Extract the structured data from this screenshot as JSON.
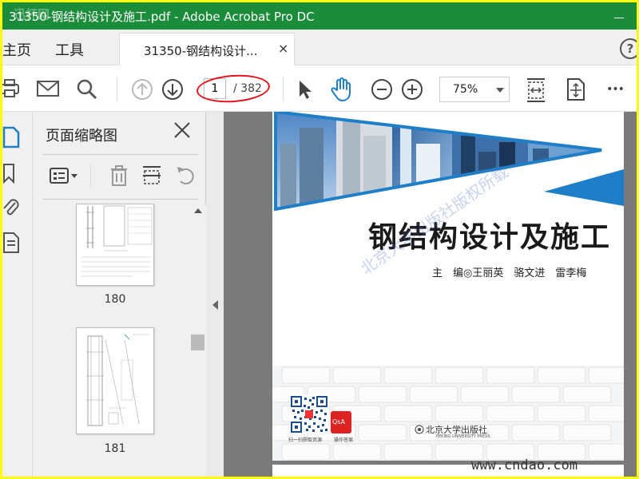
{
  "window": {
    "title": "31350-钢结构设计及施工.pdf - Adobe Acrobat Pro DC",
    "corner_watermark": "迅杯网"
  },
  "tabs": {
    "home": "主页",
    "tools": "工具",
    "document": "31350-钢结构设计...",
    "close": "×",
    "help": "?"
  },
  "toolbar": {
    "current_page": "1",
    "total_pages": "/ 382",
    "zoom": "75%",
    "more": "•••"
  },
  "icons": [
    "print-icon",
    "email-icon",
    "search-icon",
    "prev-page-icon",
    "next-page-icon",
    "select-arrow-icon",
    "hand-icon",
    "zoom-out-icon",
    "zoom-in-icon",
    "fit-width-icon",
    "fullscreen-icon",
    "more-icon"
  ],
  "panel": {
    "title": "页面缩略图",
    "thumbnails": [
      {
        "label": "180"
      },
      {
        "label": "181"
      }
    ]
  },
  "page": {
    "title": "钢结构设计及施工",
    "authors": "主　编◎王丽英　骆文进　雷李梅",
    "watermark": "北京大学出版社版权所载",
    "qr_caption": "扫一扫获取资源",
    "app_caption": "操作答案",
    "app_label": "QsA",
    "publisher": "北京大学出版社",
    "publisher_en": "PEKING UNIVERSITY PRESS",
    "site": "www.cndao.com"
  },
  "colors": {
    "titlebar": "#1a8c3a",
    "accent_blue": "#1f7ec8",
    "highlight_ring": "#e0141c",
    "frame": "#ffff00"
  }
}
